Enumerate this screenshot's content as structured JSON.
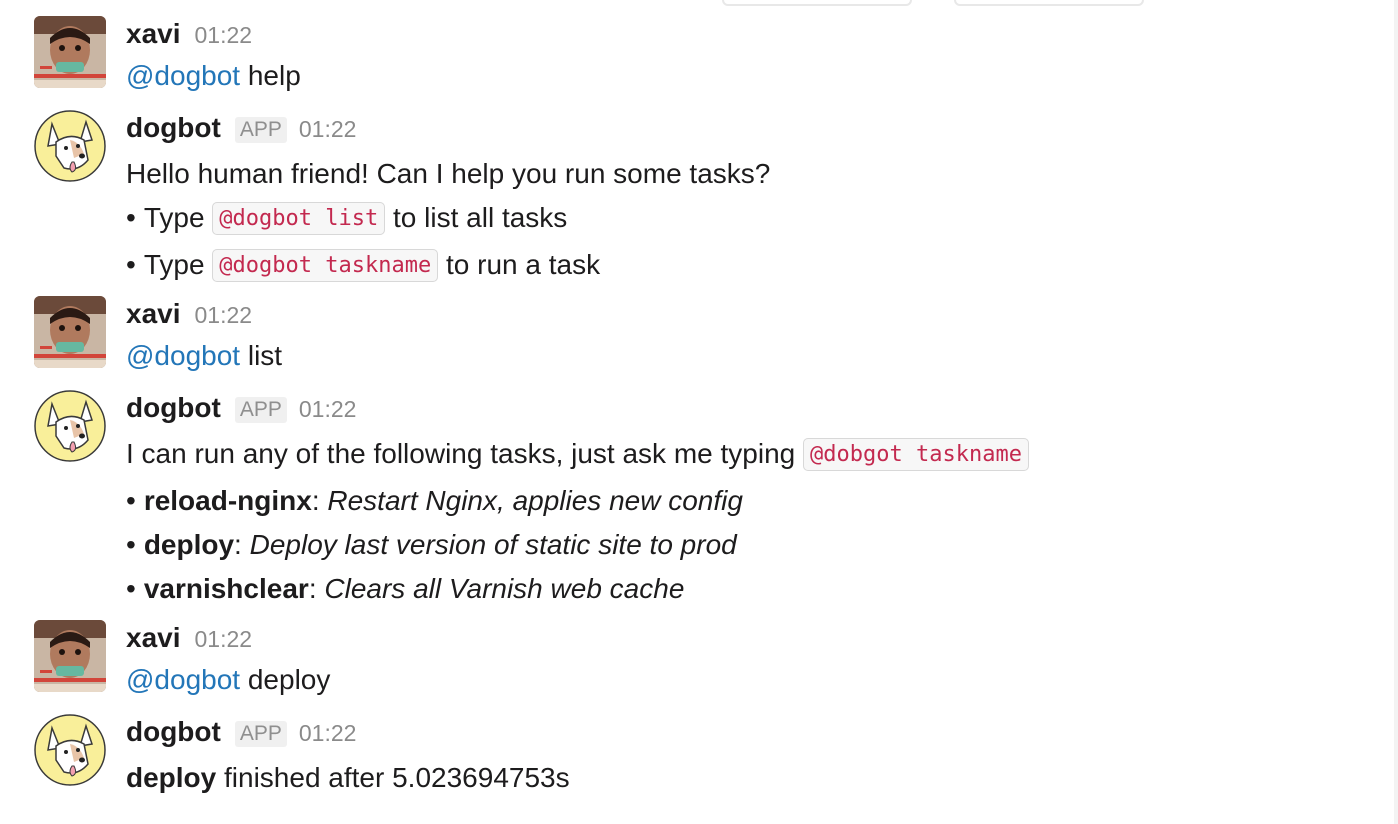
{
  "messages": [
    {
      "user": "xavi",
      "time": "01:22",
      "mention": "@dogbot",
      "text": "help"
    },
    {
      "user": "dogbot",
      "badge": "APP",
      "time": "01:22",
      "intro": "Hello human friend! Can I help you run some tasks?",
      "bullets": [
        {
          "prefix": "Type",
          "code": "@dogbot list",
          "suffix": "to list all tasks"
        },
        {
          "prefix": "Type",
          "code": "@dogbot taskname",
          "suffix": "to run a task"
        }
      ]
    },
    {
      "user": "xavi",
      "time": "01:22",
      "mention": "@dogbot",
      "text": "list"
    },
    {
      "user": "dogbot",
      "badge": "APP",
      "time": "01:22",
      "intro": "I can run any of the following tasks, just ask me typing",
      "intro_code": "@dobgot taskname",
      "tasks": [
        {
          "name": "reload-nginx",
          "desc": "Restart Nginx, applies new config"
        },
        {
          "name": "deploy",
          "desc": "Deploy last version of static site to prod"
        },
        {
          "name": "varnishclear",
          "desc": "Clears all Varnish web cache"
        }
      ]
    },
    {
      "user": "xavi",
      "time": "01:22",
      "mention": "@dogbot",
      "text": "deploy"
    },
    {
      "user": "dogbot",
      "badge": "APP",
      "time": "01:22",
      "result_bold": "deploy",
      "result_text": "finished after 5.023694753s"
    }
  ],
  "bullet_char": "•",
  "colors": {
    "mention": "#2376b8",
    "code_text": "#c3294f",
    "timestamp": "#8a8a8a"
  }
}
